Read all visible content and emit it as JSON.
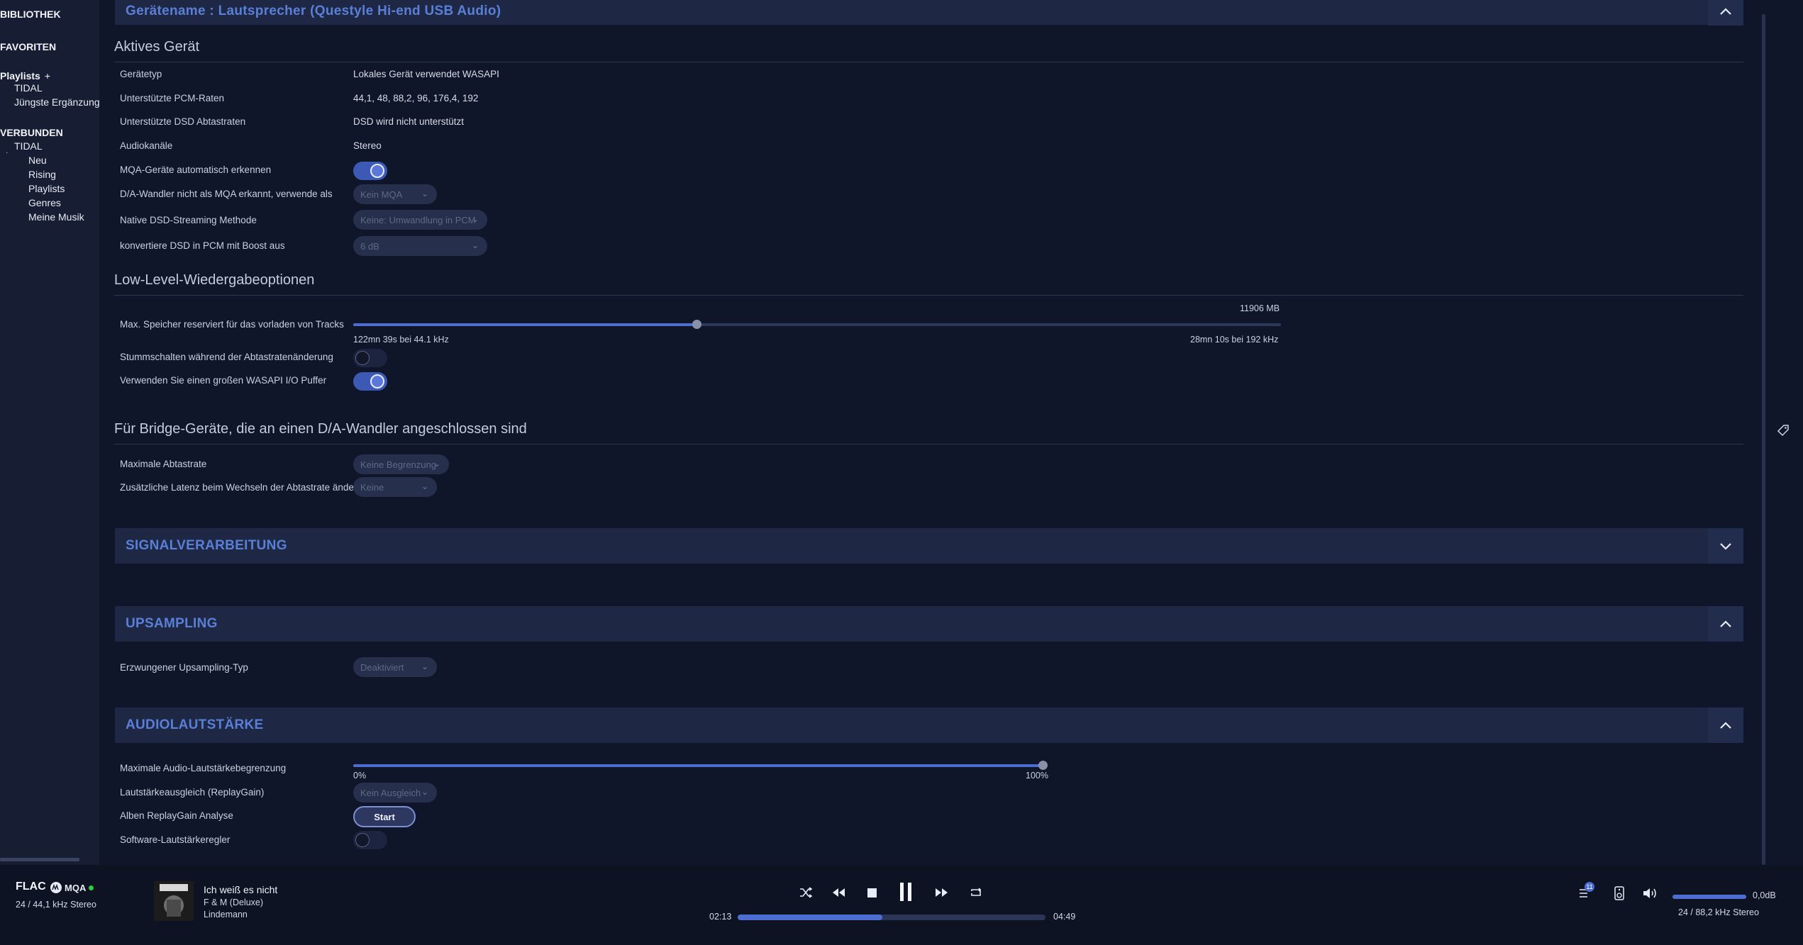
{
  "sidebar": {
    "bibliothek": "BIBLIOTHEK",
    "favoriten": "FAVORITEN",
    "playlists": "Playlists",
    "playlists_plus": "+",
    "playlist_items": [
      "TIDAL",
      "Jüngste Ergänzung"
    ],
    "verbunden": "VERBUNDEN",
    "tidal": "TIDAL",
    "tidal_items": [
      "Neu",
      "Rising",
      "Playlists",
      "Genres",
      "Meine Musik"
    ]
  },
  "device_bar": {
    "title": "Gerätename : Lautsprecher (Questyle Hi-end USB Audio)"
  },
  "active_device": {
    "title": "Aktives Gerät",
    "geraetetyp_label": "Gerätetyp",
    "geraetetyp_value": "Lokales Gerät verwendet WASAPI",
    "pcm_label": "Unterstützte PCM-Raten",
    "pcm_value": "44,1, 48, 88,2, 96, 176,4, 192",
    "dsd_label": "Unterstützte DSD Abtastraten",
    "dsd_value": "DSD wird nicht unterstützt",
    "channels_label": "Audiokanäle",
    "channels_value": "Stereo",
    "mqa_auto_label": "MQA-Geräte automatisch erkennen",
    "mqa_auto_on": true,
    "dac_mqa_label": "D/A-Wandler nicht als MQA erkannt, verwende als",
    "dac_mqa_value": "Kein MQA",
    "native_dsd_label": "Native DSD-Streaming Methode",
    "native_dsd_value": "Keine: Umwandlung in PCM",
    "dsd_pcm_boost_label": "konvertiere DSD in PCM mit Boost aus",
    "dsd_pcm_boost_value": "6 dB"
  },
  "low_level": {
    "title": "Low-Level-Wiedergabeoptionen",
    "mem_label": "Max. Speicher reserviert für das vorladen von Tracks",
    "mem_value": "11906 MB",
    "mem_level": 0.37,
    "mem_left": "122mn 39s bei 44.1 kHz",
    "mem_right": "28mn 10s bei 192 kHz",
    "mute_label": "Stummschalten während der Abtastratenänderung",
    "mute_on": false,
    "wasapi_label": "Verwenden Sie einen großen WASAPI I/O Puffer",
    "wasapi_on": true
  },
  "bridge": {
    "title": "Für Bridge-Geräte, die an einen D/A-Wandler angeschlossen sind",
    "max_rate_label": "Maximale Abtastrate",
    "max_rate_value": "Keine Begrenzung",
    "latency_label": "Zusätzliche Latenz beim Wechseln der Abtastrate ändern",
    "latency_value": "Keine"
  },
  "signal": {
    "title": "SIGNALVERARBEITUNG"
  },
  "upsampling": {
    "title": "UPSAMPLING",
    "type_label": "Erzwungener Upsampling-Typ",
    "type_value": "Deaktiviert"
  },
  "volume": {
    "title": "AUDIOLAUTSTÄRKE",
    "max_label": "Maximale Audio-Lautstärkebegrenzung",
    "max_level": 1.0,
    "min_tick": "0%",
    "max_tick": "100%",
    "replaygain_label": "Lautstärkeausgleich (ReplayGain)",
    "replaygain_value": "Kein Ausgleich",
    "analysis_label": "Alben ReplayGain Analyse",
    "analysis_button": "Start",
    "software_label": "Software-Lautstärkeregler",
    "software_on": false
  },
  "player": {
    "format": "FLAC",
    "mqa": "MQA",
    "source_quality": "24 / 44,1 kHz Stereo",
    "track_title": "Ich weiß es nicht",
    "album": "F & M (Deluxe)",
    "artist": "Lindemann",
    "elapsed": "02:13",
    "total": "04:49",
    "progress": 0.47,
    "queue_count": "11",
    "volume_db": "0,0dB",
    "output_quality": "24 / 88,2 kHz Stereo",
    "volume_level": 1.0
  },
  "colors": {
    "accent": "#4d6dd0",
    "bar_title": "#5a7fd6",
    "background": "#10162a",
    "mqa_dot": "#2ecc40"
  }
}
